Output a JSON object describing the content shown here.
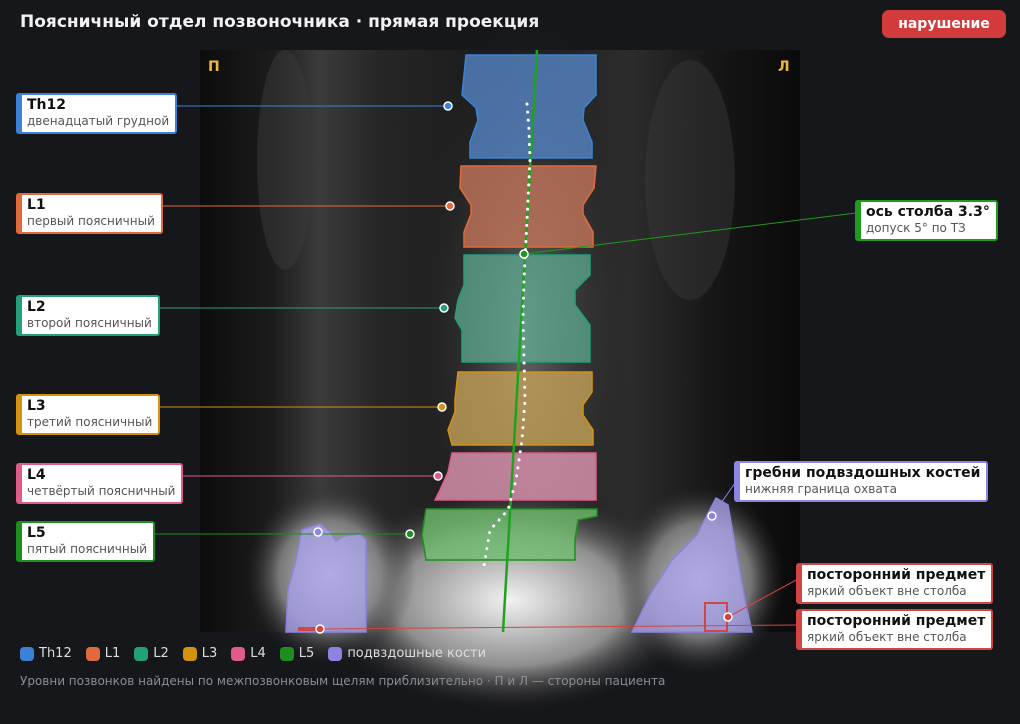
{
  "header": {
    "title": "Поясничный отдел позвоночника · прямая проекция",
    "status_badge": "нарушение"
  },
  "image": {
    "side_right_marker": "П",
    "side_left_marker": "Л"
  },
  "vertebrae": [
    {
      "id": "Th12",
      "name": "Th12",
      "description": "двенадцатый грудной",
      "color": "#3b82d6"
    },
    {
      "id": "L1",
      "name": "L1",
      "description": "первый поясничный",
      "color": "#e06a3b"
    },
    {
      "id": "L2",
      "name": "L2",
      "description": "второй поясничный",
      "color": "#22a07a"
    },
    {
      "id": "L3",
      "name": "L3",
      "description": "третий поясничный",
      "color": "#d4920f"
    },
    {
      "id": "L4",
      "name": "L4",
      "description": "четвёртый поясничный",
      "color": "#e05a8a"
    },
    {
      "id": "L5",
      "name": "L5",
      "description": "пятый поясничный",
      "color": "#1e8f1e"
    }
  ],
  "axis_annotation": {
    "title": "ось столба 3.3°",
    "subtitle": "допуск 5° по ТЗ",
    "color": "#1e9b1e"
  },
  "iliac_annotation": {
    "title": "гребни подвздошных костей",
    "subtitle": "нижняя граница охвата",
    "color": "#8b84e0"
  },
  "foreign_objects": [
    {
      "title": "посторонний предмет",
      "subtitle": "яркий объект вне столба",
      "color": "#d24545"
    },
    {
      "title": "посторонний предмет",
      "subtitle": "яркий объект вне столба",
      "color": "#d24545"
    }
  ],
  "legend": {
    "items": [
      {
        "label": "Th12",
        "color": "#3b82d6"
      },
      {
        "label": "L1",
        "color": "#e06a3b"
      },
      {
        "label": "L2",
        "color": "#22a07a"
      },
      {
        "label": "L3",
        "color": "#d4920f"
      },
      {
        "label": "L4",
        "color": "#e05a8a"
      },
      {
        "label": "L5",
        "color": "#1e8f1e"
      },
      {
        "label": "подвздошные кости",
        "color": "#8b84e0"
      }
    ]
  },
  "footnote": "Уровни позвонков найдены по межпозвонковым щелям приблизительно · П и Л — стороны пациента"
}
